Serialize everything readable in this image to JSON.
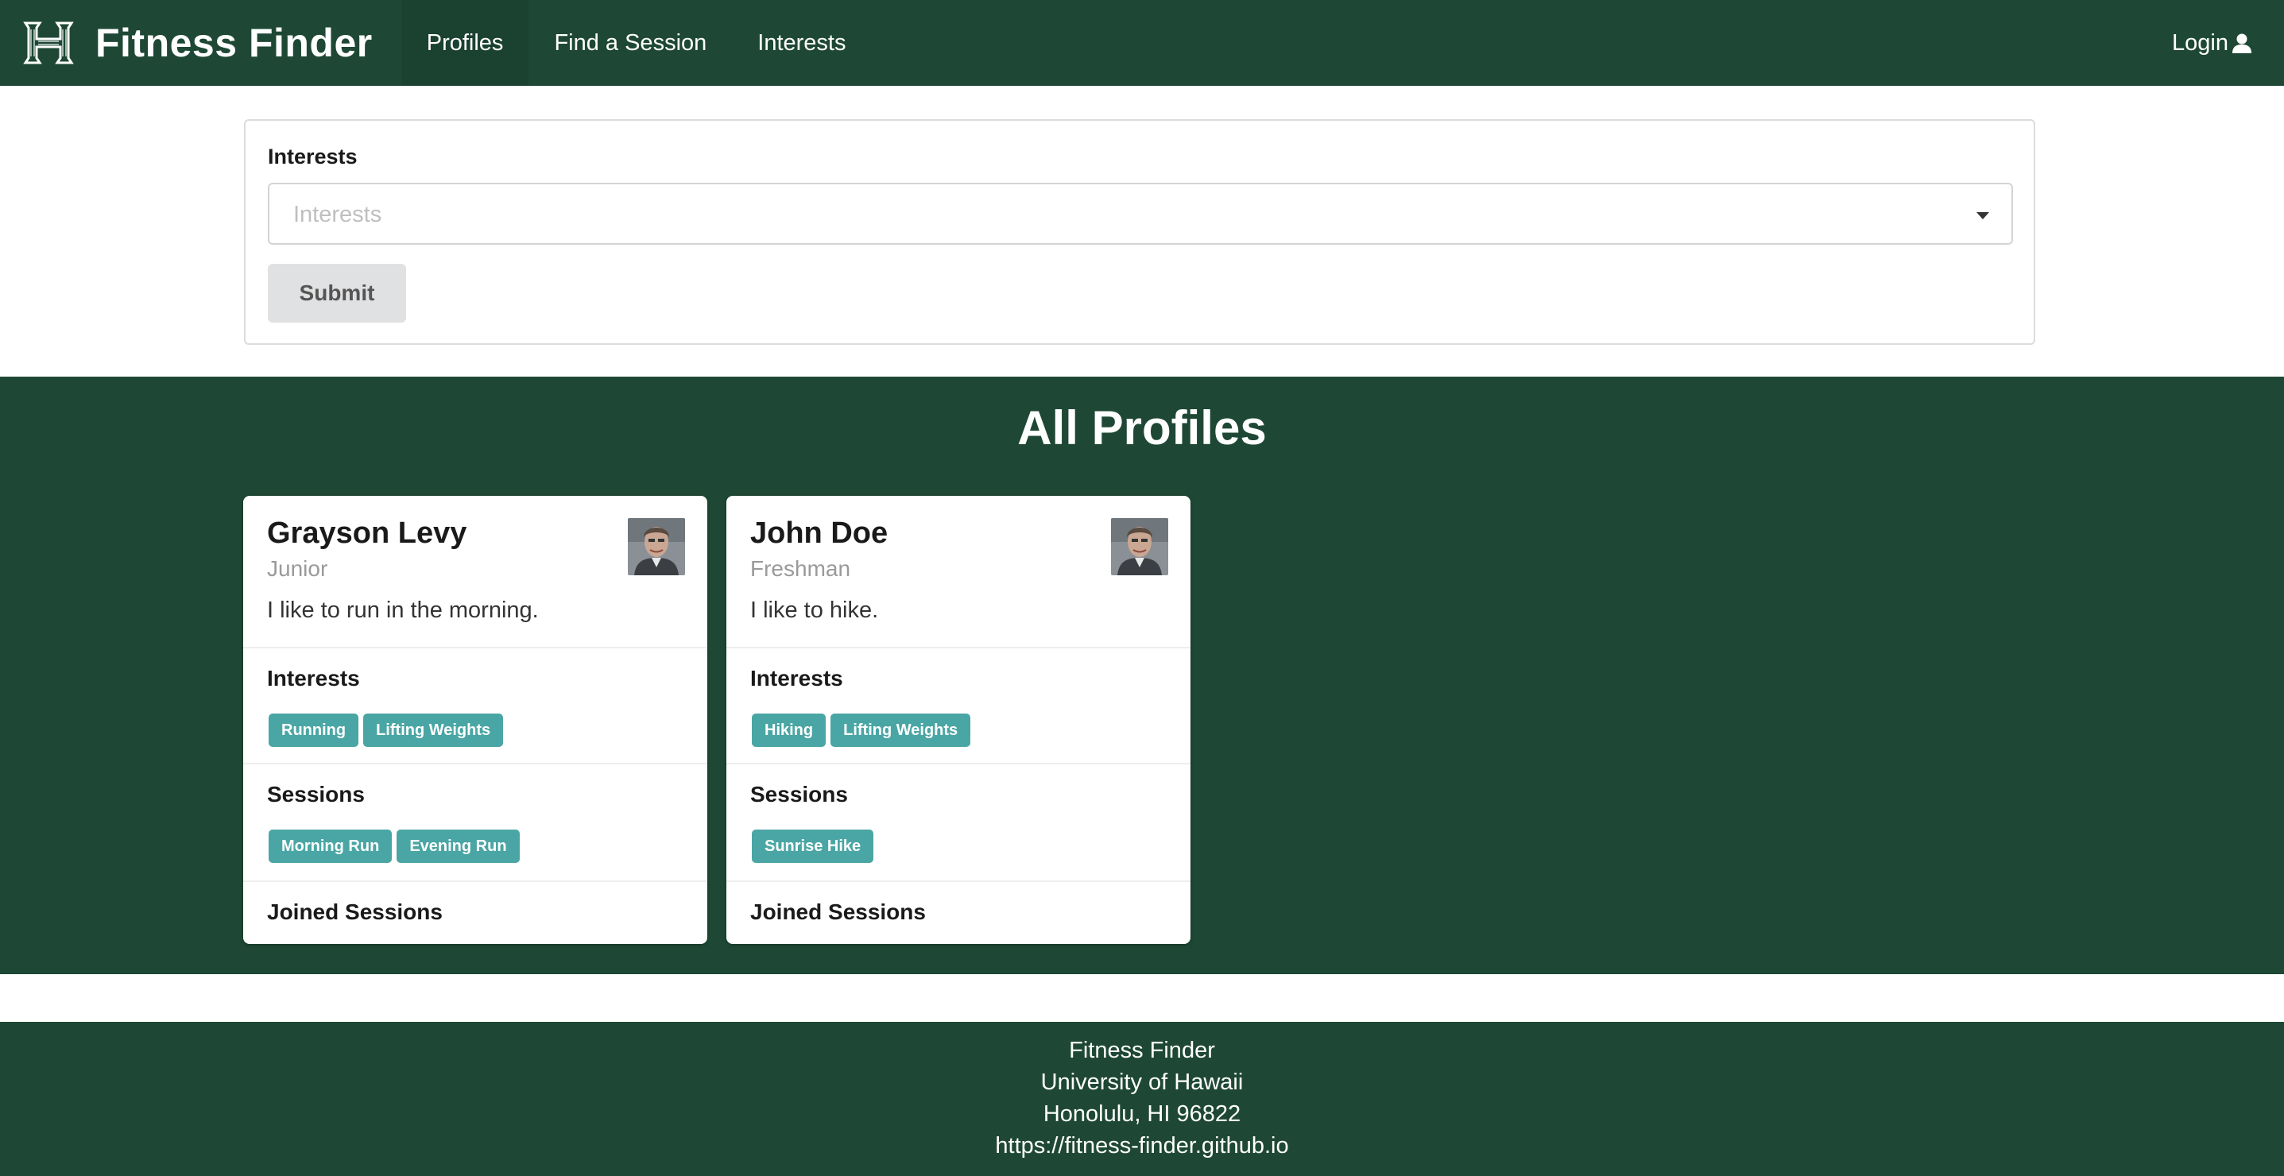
{
  "app": {
    "brand": "Fitness Finder",
    "logo_icon": "uh-h-logo-icon",
    "theme_color": "#1e4835",
    "tag_color": "#4aa6a4"
  },
  "nav": {
    "links": [
      "Profiles",
      "Find a Session",
      "Interests"
    ],
    "active": "Profiles",
    "login_label": "Login",
    "login_icon": "user-icon"
  },
  "filter": {
    "label": "Interests",
    "placeholder": "Interests",
    "submit_label": "Submit"
  },
  "profiles_section": {
    "title": "All Profiles",
    "labels": {
      "interests": "Interests",
      "sessions": "Sessions",
      "joined": "Joined Sessions"
    },
    "profiles": [
      {
        "name": "Grayson Levy",
        "year": "Junior",
        "bio": "I like to run in the morning.",
        "interests": [
          "Running",
          "Lifting Weights"
        ],
        "sessions": [
          "Morning Run",
          "Evening Run"
        ],
        "joined": []
      },
      {
        "name": "John Doe",
        "year": "Freshman",
        "bio": "I like to hike.",
        "interests": [
          "Hiking",
          "Lifting Weights"
        ],
        "sessions": [
          "Sunrise Hike"
        ],
        "joined": []
      }
    ]
  },
  "footer": {
    "lines": [
      "Fitness Finder",
      "University of Hawaii",
      "Honolulu, HI 96822",
      "https://fitness-finder.github.io"
    ]
  }
}
